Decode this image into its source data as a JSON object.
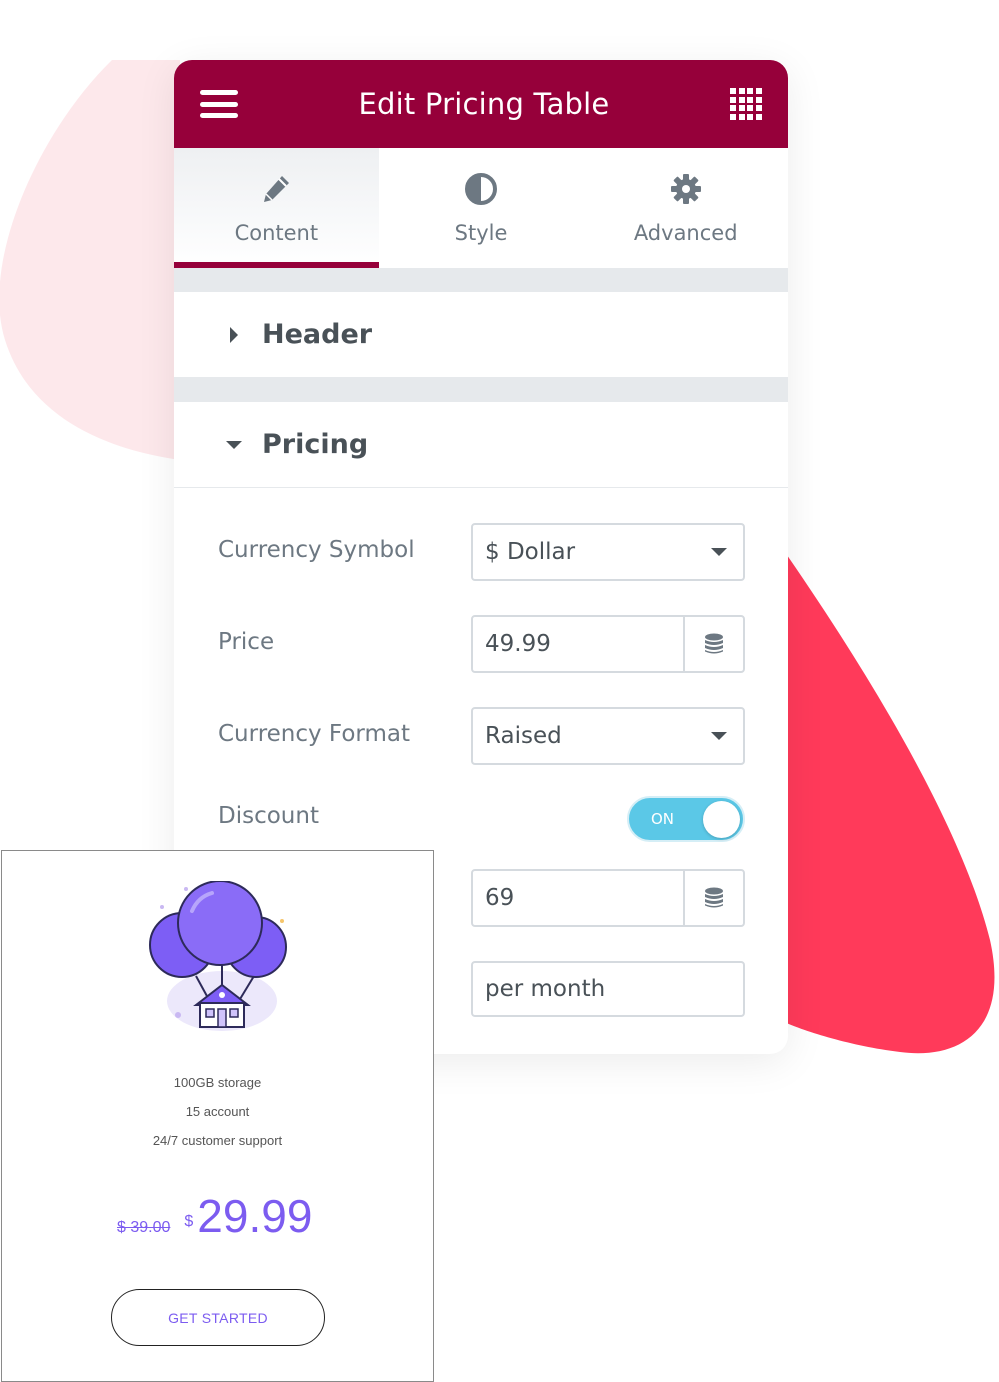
{
  "colors": {
    "brand": "#96003a",
    "accent_pink_blob": "#fde8eb",
    "accent_red_blob": "#ff3a5a",
    "toggle_on": "#5bc8e7",
    "price_purple": "#7c5cf0"
  },
  "editor": {
    "title": "Edit Pricing Table",
    "menu_icon": "hamburger-icon",
    "apps_icon": "grid-icon",
    "tabs": [
      {
        "label": "Content",
        "icon": "pencil-icon",
        "active": true
      },
      {
        "label": "Style",
        "icon": "half-circle-icon",
        "active": false
      },
      {
        "label": "Advanced",
        "icon": "gear-icon",
        "active": false
      }
    ],
    "sections": {
      "header": {
        "title": "Header",
        "expanded": false
      },
      "pricing": {
        "title": "Pricing",
        "expanded": true
      }
    },
    "controls": {
      "currency_symbol": {
        "label": "Currency Symbol",
        "value": "$ Dollar"
      },
      "price": {
        "label": "Price",
        "value": "49.99"
      },
      "currency_format": {
        "label": "Currency Format",
        "value": "Raised"
      },
      "discount": {
        "label": "Discount",
        "toggle_text": "ON",
        "on": true
      },
      "sale_price": {
        "value": "69"
      },
      "period": {
        "value": "per month"
      }
    }
  },
  "card": {
    "features": [
      "100GB storage",
      "15 account",
      "24/7 customer support"
    ],
    "old_price": "$ 39.00",
    "currency": "$",
    "new_price": "29.99",
    "button_label": "GET STARTED"
  }
}
